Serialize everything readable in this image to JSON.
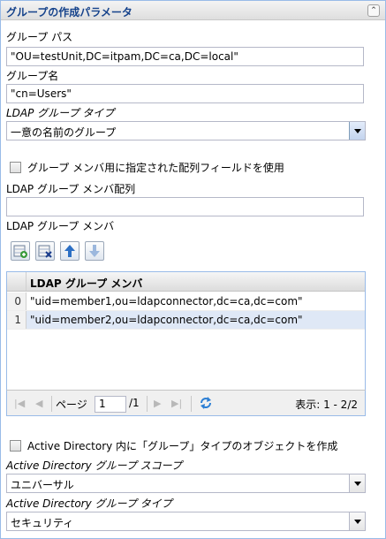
{
  "panel": {
    "title": "グループの作成パラメータ"
  },
  "group_path": {
    "label": "グループ パス",
    "value": "\"OU=testUnit,DC=itpam,DC=ca,DC=local\""
  },
  "group_name": {
    "label": "グループ名",
    "value": "\"cn=Users\""
  },
  "ldap_group_type": {
    "label": "LDAP グループ タイプ",
    "selected": "一意の名前のグループ"
  },
  "use_array_field": {
    "label": "グループ メンバ用に指定された配列フィールドを使用",
    "checked": false
  },
  "member_array": {
    "label": "LDAP グループ メンバ配列",
    "value": ""
  },
  "members": {
    "label": "LDAP グループ メンバ",
    "toolbar": {
      "add_icon": "add-row-icon",
      "delete_icon": "delete-row-icon",
      "up_icon": "arrow-up-icon",
      "down_icon": "arrow-down-icon"
    },
    "column_header": "LDAP グループ メンバ",
    "rows": [
      {
        "index": "0",
        "value": "\"uid=member1,ou=ldapconnector,dc=ca,dc=com\""
      },
      {
        "index": "1",
        "value": "\"uid=member2,ou=ldapconnector,dc=ca,dc=com\""
      }
    ],
    "pager": {
      "page_label": "ページ",
      "page_value": "1",
      "total_label": "/1",
      "display": "表示: 1 - 2/2"
    }
  },
  "ad_object": {
    "label": "Active Directory 内に「グループ」タイプのオブジェクトを作成",
    "checked": false
  },
  "ad_scope": {
    "label": "Active Directory グループ スコープ",
    "selected": "ユニバーサル"
  },
  "ad_type": {
    "label": "Active Directory グループ タイプ",
    "selected": "セキュリティ"
  },
  "colors": {
    "header_text": "#15428b",
    "selected_row": "#dfe8f6",
    "border": "#99bbe8"
  }
}
